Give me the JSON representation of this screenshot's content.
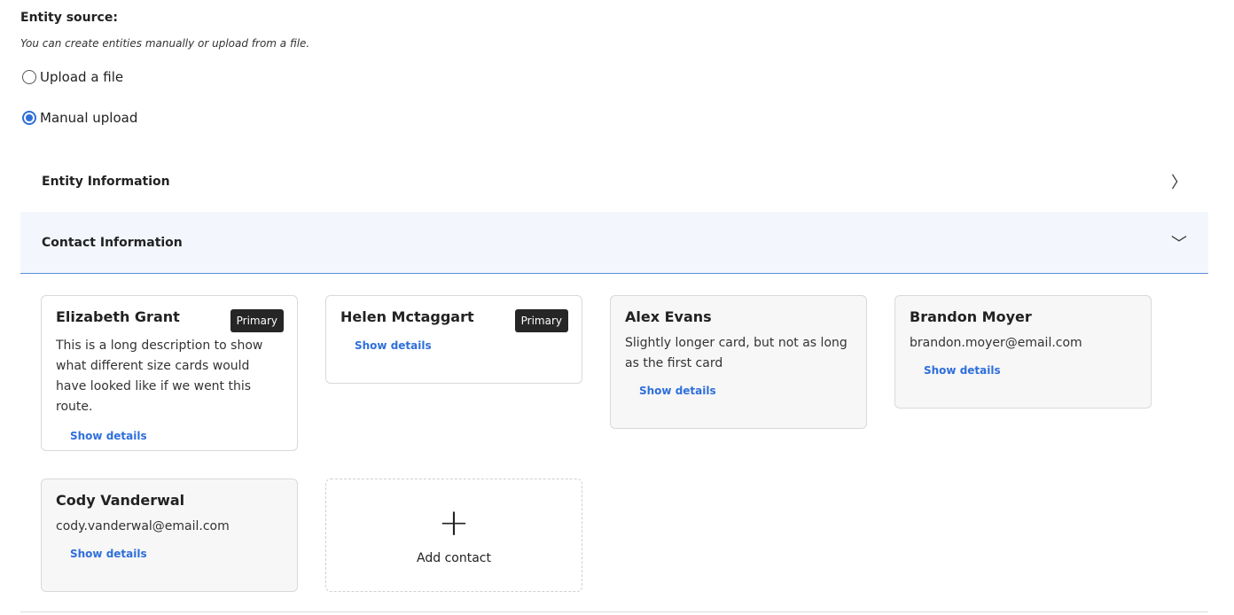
{
  "entity_source": {
    "label": "Entity source:",
    "help": "You can create entities manually or upload from a file.",
    "options": [
      {
        "label": "Upload a file",
        "selected": false
      },
      {
        "label": "Manual upload",
        "selected": true
      }
    ]
  },
  "sections": [
    {
      "title": "Entity Information",
      "expanded": false,
      "icon": "chevron-right-icon",
      "glyph": "〉"
    },
    {
      "title": "Contact Information",
      "expanded": true,
      "icon": "chevron-down-icon",
      "glyph": "﹀"
    }
  ],
  "contacts": [
    {
      "name": "Elizabeth Grant",
      "badge": "Primary",
      "description": "This is a long description to show what different size cards would have looked like if we went this route.",
      "link": "Show details"
    },
    {
      "name": "Helen Mctaggart",
      "badge": "Primary",
      "link": "Show details"
    },
    {
      "name": "Alex Evans",
      "description": "Slightly longer card, but not as long as the first card",
      "link": "Show details"
    },
    {
      "name": "Brandon Moyer",
      "description": "brandon.moyer@email.com",
      "link": "Show details"
    },
    {
      "name": "Cody Vanderwal",
      "description": "cody.vanderwal@email.com",
      "link": "Show details"
    }
  ],
  "add_contact": {
    "label": "Add contact",
    "icon": "plus-icon",
    "glyph": "+"
  },
  "colors": {
    "accent": "#2f6fdb",
    "badge_bg": "#262626",
    "expanded_bg": "#f3f7fd"
  }
}
